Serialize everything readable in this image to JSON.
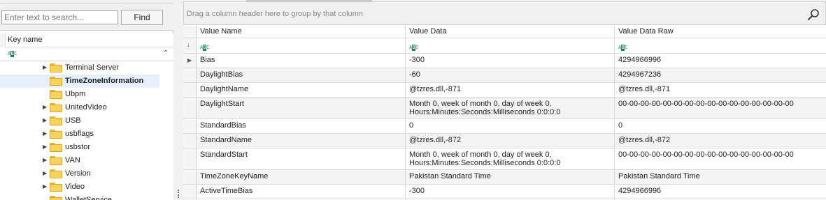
{
  "search": {
    "placeholder": "Enter text to search...",
    "find_label": "Find"
  },
  "tree": {
    "column_header": "Key name",
    "filter_icon": "abc-filter-icon",
    "items": [
      {
        "label": "Terminal Server",
        "expandable": true,
        "selected": false
      },
      {
        "label": "TimeZoneInformation",
        "expandable": false,
        "selected": true
      },
      {
        "label": "Ubpm",
        "expandable": false,
        "selected": false
      },
      {
        "label": "UnitedVideo",
        "expandable": true,
        "selected": false
      },
      {
        "label": "USB",
        "expandable": true,
        "selected": false
      },
      {
        "label": "usbflags",
        "expandable": true,
        "selected": false
      },
      {
        "label": "usbstor",
        "expandable": true,
        "selected": false
      },
      {
        "label": "VAN",
        "expandable": true,
        "selected": false
      },
      {
        "label": "Version",
        "expandable": true,
        "selected": false
      },
      {
        "label": "Video",
        "expandable": true,
        "selected": false
      },
      {
        "label": "WalletService",
        "expandable": false,
        "selected": false
      }
    ]
  },
  "values_grid": {
    "group_hint": "Drag a column header here to group by that column",
    "columns": [
      "Value Name",
      "Value Data",
      "Value Data Raw"
    ],
    "rows": [
      {
        "name": "Bias",
        "data": [
          "-300"
        ],
        "raw": "4294966996"
      },
      {
        "name": "DaylightBias",
        "data": [
          "-60"
        ],
        "raw": "4294967236"
      },
      {
        "name": "DaylightName",
        "data": [
          "@tzres.dll,-871"
        ],
        "raw": "@tzres.dll,-871"
      },
      {
        "name": "DaylightStart",
        "data": [
          "Month 0, week of month 0, day of week 0,",
          "Hours:Minutes:Seconds:Milliseconds 0:0:0:0"
        ],
        "raw": "00-00-00-00-00-00-00-00-00-00-00-00-00-00-00-00"
      },
      {
        "name": "StandardBias",
        "data": [
          "0"
        ],
        "raw": "0"
      },
      {
        "name": "StandardName",
        "data": [
          "@tzres.dll,-872"
        ],
        "raw": "@tzres.dll,-872"
      },
      {
        "name": "StandardStart",
        "data": [
          "Month 0, week of month 0, day of week 0,",
          "Hours:Minutes:Seconds:Milliseconds 0:0:0:0"
        ],
        "raw": "00-00-00-00-00-00-00-00-00-00-00-00-00-00-00-00"
      },
      {
        "name": "TimeZoneKeyName",
        "data": [
          "Pakistan Standard Time"
        ],
        "raw": "Pakistan Standard Time"
      },
      {
        "name": "ActiveTimeBias",
        "data": [
          "-300"
        ],
        "raw": "4294966996"
      }
    ]
  },
  "colors": {
    "folder": "#f9d25c",
    "selection": "#e6f0fa",
    "filter_icon": "#2a7a6a"
  }
}
